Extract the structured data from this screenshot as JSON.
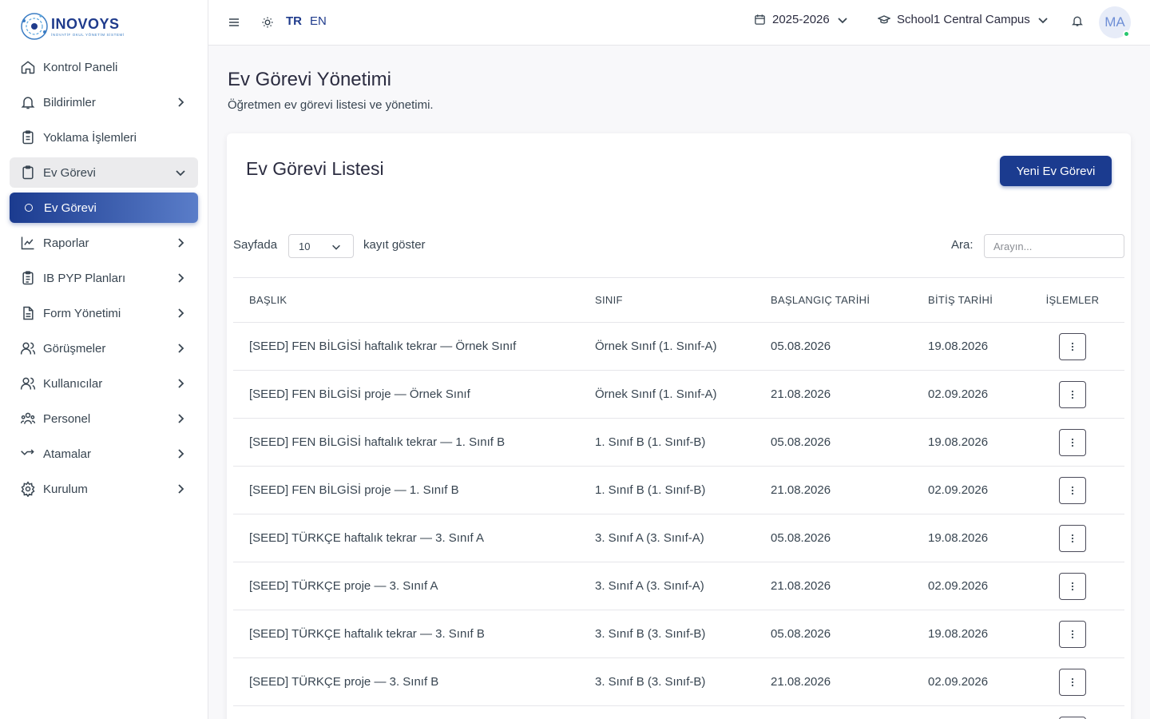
{
  "brand": {
    "name": "INOVOYS",
    "tagline": "İNOVATİF OKUL YÖNETİM SİSTEMİ"
  },
  "sidebar": {
    "items": [
      {
        "label": "Kontrol Paneli",
        "icon": "home-icon",
        "chevron": false
      },
      {
        "label": "Bildirimler",
        "icon": "bell-icon",
        "chevron": true
      },
      {
        "label": "Yoklama İşlemleri",
        "icon": "clipboard-check-icon",
        "chevron": false
      },
      {
        "label": "Ev Görevi",
        "icon": "clipboard-icon",
        "chevron": "down",
        "open": true
      },
      {
        "label": "Ev Görevi",
        "icon": "circle-icon",
        "active": true
      },
      {
        "label": "Raporlar",
        "icon": "chart-icon",
        "chevron": true
      },
      {
        "label": "IB PYP Planları",
        "icon": "clipboard-list-icon",
        "chevron": true
      },
      {
        "label": "Form Yönetimi",
        "icon": "file-text-icon",
        "chevron": true
      },
      {
        "label": "Görüşmeler",
        "icon": "users-icon",
        "chevron": true
      },
      {
        "label": "Kullanıcılar",
        "icon": "users-icon",
        "chevron": true
      },
      {
        "label": "Personel",
        "icon": "team-icon",
        "chevron": true
      },
      {
        "label": "Atamalar",
        "icon": "arrow-right-icon",
        "chevron": true
      },
      {
        "label": "Kurulum",
        "icon": "gear-icon",
        "chevron": true
      }
    ]
  },
  "topbar": {
    "lang_tr": "TR",
    "lang_en": "EN",
    "year": "2025-2026",
    "campus": "School1 Central Campus",
    "avatar": "MA"
  },
  "page": {
    "title": "Ev Görevi Yönetimi",
    "subtitle": "Öğretmen ev görevi listesi ve yönetimi."
  },
  "card": {
    "title": "Ev Görevi Listesi",
    "new_button": "Yeni Ev Görevi",
    "length_prefix": "Sayfada",
    "length_value": "10",
    "length_suffix": "kayıt göster",
    "search_label": "Ara:",
    "search_placeholder": "Arayın..."
  },
  "table": {
    "headers": [
      "BAŞLIK",
      "SINIF",
      "BAŞLANGIÇ TARİHİ",
      "BİTİŞ TARİHİ",
      "İŞLEMLER"
    ],
    "rows": [
      [
        "[SEED] FEN BİLGİSİ haftalık tekrar — Örnek Sınıf",
        "Örnek Sınıf (1. Sınıf-A)",
        "05.08.2026",
        "19.08.2026"
      ],
      [
        "[SEED] FEN BİLGİSİ proje — Örnek Sınıf",
        "Örnek Sınıf (1. Sınıf-A)",
        "21.08.2026",
        "02.09.2026"
      ],
      [
        "[SEED] FEN BİLGİSİ haftalık tekrar — 1. Sınıf B",
        "1. Sınıf B (1. Sınıf-B)",
        "05.08.2026",
        "19.08.2026"
      ],
      [
        "[SEED] FEN BİLGİSİ proje — 1. Sınıf B",
        "1. Sınıf B (1. Sınıf-B)",
        "21.08.2026",
        "02.09.2026"
      ],
      [
        "[SEED] TÜRKÇE haftalık tekrar — 3. Sınıf A",
        "3. Sınıf A (3. Sınıf-A)",
        "05.08.2026",
        "19.08.2026"
      ],
      [
        "[SEED] TÜRKÇE proje — 3. Sınıf A",
        "3. Sınıf A (3. Sınıf-A)",
        "21.08.2026",
        "02.09.2026"
      ],
      [
        "[SEED] TÜRKÇE haftalık tekrar — 3. Sınıf B",
        "3. Sınıf B (3. Sınıf-B)",
        "05.08.2026",
        "19.08.2026"
      ],
      [
        "[SEED] TÜRKÇE proje — 3. Sınıf B",
        "3. Sınıf B (3. Sınıf-B)",
        "21.08.2026",
        "02.09.2026"
      ],
      [
        "",
        "",
        "",
        ""
      ]
    ]
  }
}
